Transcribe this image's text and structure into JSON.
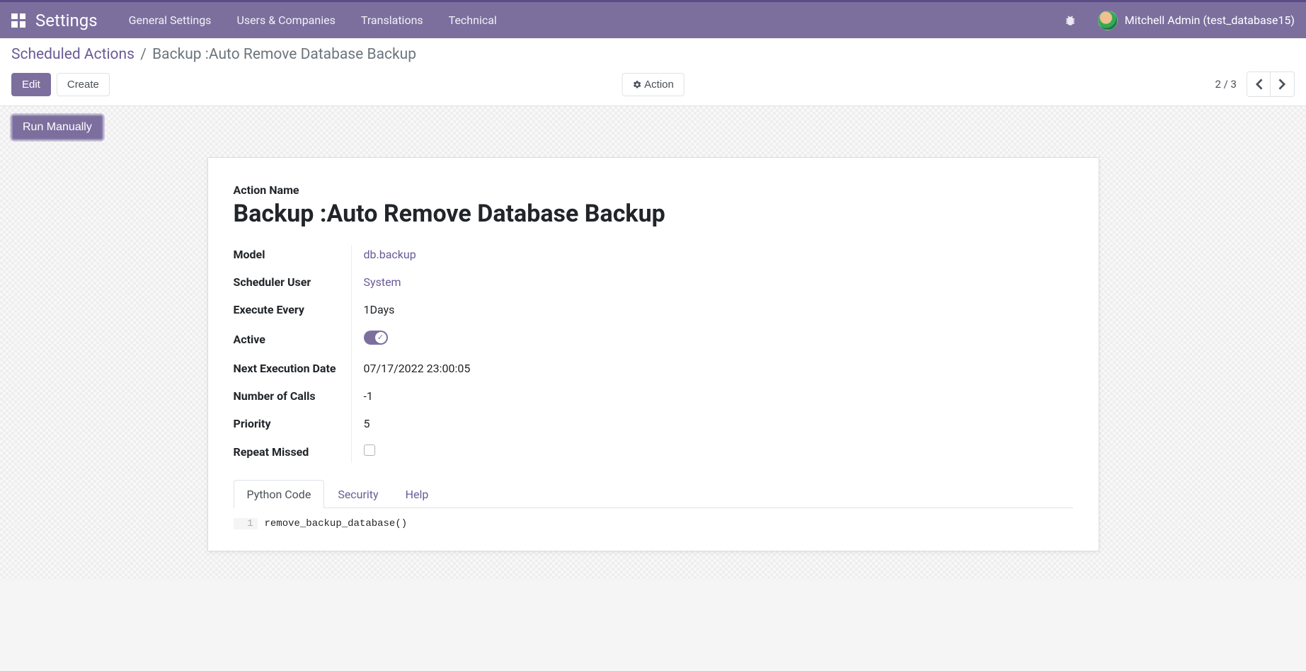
{
  "nav": {
    "app_title": "Settings",
    "menu": [
      "General Settings",
      "Users & Companies",
      "Translations",
      "Technical"
    ],
    "user_name": "Mitchell Admin (test_database15)"
  },
  "breadcrumb": {
    "parent": "Scheduled Actions",
    "sep": "/",
    "current": "Backup :Auto Remove Database Backup"
  },
  "buttons": {
    "edit": "Edit",
    "create": "Create",
    "action": "Action",
    "run_manually": "Run Manually"
  },
  "pager": {
    "text": "2 / 3"
  },
  "form": {
    "action_name_label": "Action Name",
    "action_name": "Backup :Auto Remove Database Backup",
    "fields": {
      "model": {
        "label": "Model",
        "value": "db.backup",
        "is_link": true
      },
      "scheduler_user": {
        "label": "Scheduler User",
        "value": "System",
        "is_link": true
      },
      "execute_every": {
        "label": "Execute Every",
        "value": "1Days"
      },
      "active": {
        "label": "Active",
        "value": true
      },
      "next_exec": {
        "label": "Next Execution Date",
        "value": "07/17/2022 23:00:05"
      },
      "num_calls": {
        "label": "Number of Calls",
        "value": "-1"
      },
      "priority": {
        "label": "Priority",
        "value": "5"
      },
      "repeat_missed": {
        "label": "Repeat Missed",
        "value": false
      }
    }
  },
  "tabs": {
    "items": [
      "Python Code",
      "Security",
      "Help"
    ],
    "active_index": 0
  },
  "code": {
    "line_no": "1",
    "content": "remove_backup_database()"
  }
}
